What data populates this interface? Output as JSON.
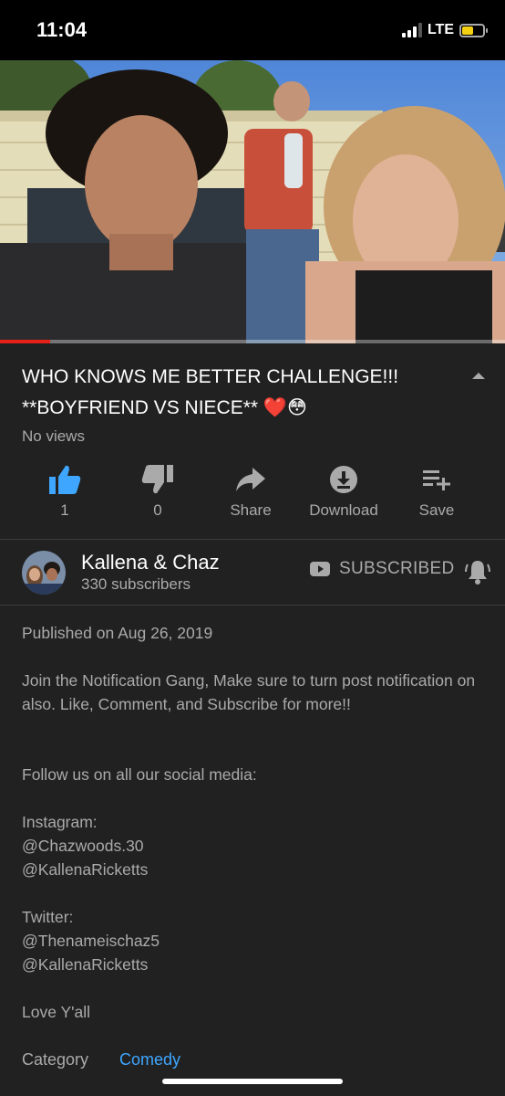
{
  "status_bar": {
    "time": "11:04",
    "network": "LTE",
    "battery_level": 0.6,
    "battery_color": "#f5cf12"
  },
  "video": {
    "progress": 0.1,
    "progress_color": "#e62117",
    "title": "WHO KNOWS ME BETTER CHALLENGE!!! **BOYFRIEND VS NIECE** ❤️😳",
    "views": "No views"
  },
  "actions": {
    "like": {
      "icon": "thumbs-up-icon",
      "label": "1",
      "color": "#3ea6ff"
    },
    "dislike": {
      "icon": "thumbs-down-icon",
      "label": "0"
    },
    "share": {
      "icon": "share-icon",
      "label": "Share"
    },
    "download": {
      "icon": "download-icon",
      "label": "Download"
    },
    "save": {
      "icon": "playlist-add-icon",
      "label": "Save"
    }
  },
  "channel": {
    "name": "Kallena & Chaz",
    "subscribers": "330 subscribers",
    "subscribe_label": "SUBSCRIBED",
    "bell_icon": "notification-bell-icon"
  },
  "description": {
    "published": "Published on Aug 26, 2019",
    "paragraph_1": "Join the Notification Gang, Make sure to turn post notification on also. Like, Comment, and Subscribe for more!!",
    "paragraph_2": "Follow us on all our social media:",
    "instagram_heading": "Instagram:",
    "instagram_1": "@Chazwoods.30",
    "instagram_2": "@KallenaRicketts",
    "twitter_heading": "Twitter:",
    "twitter_1": "@Thenameischaz5",
    "twitter_2": "@KallenaRicketts",
    "closing": "Love Y'all",
    "category_label": "Category",
    "category_value": "Comedy"
  }
}
